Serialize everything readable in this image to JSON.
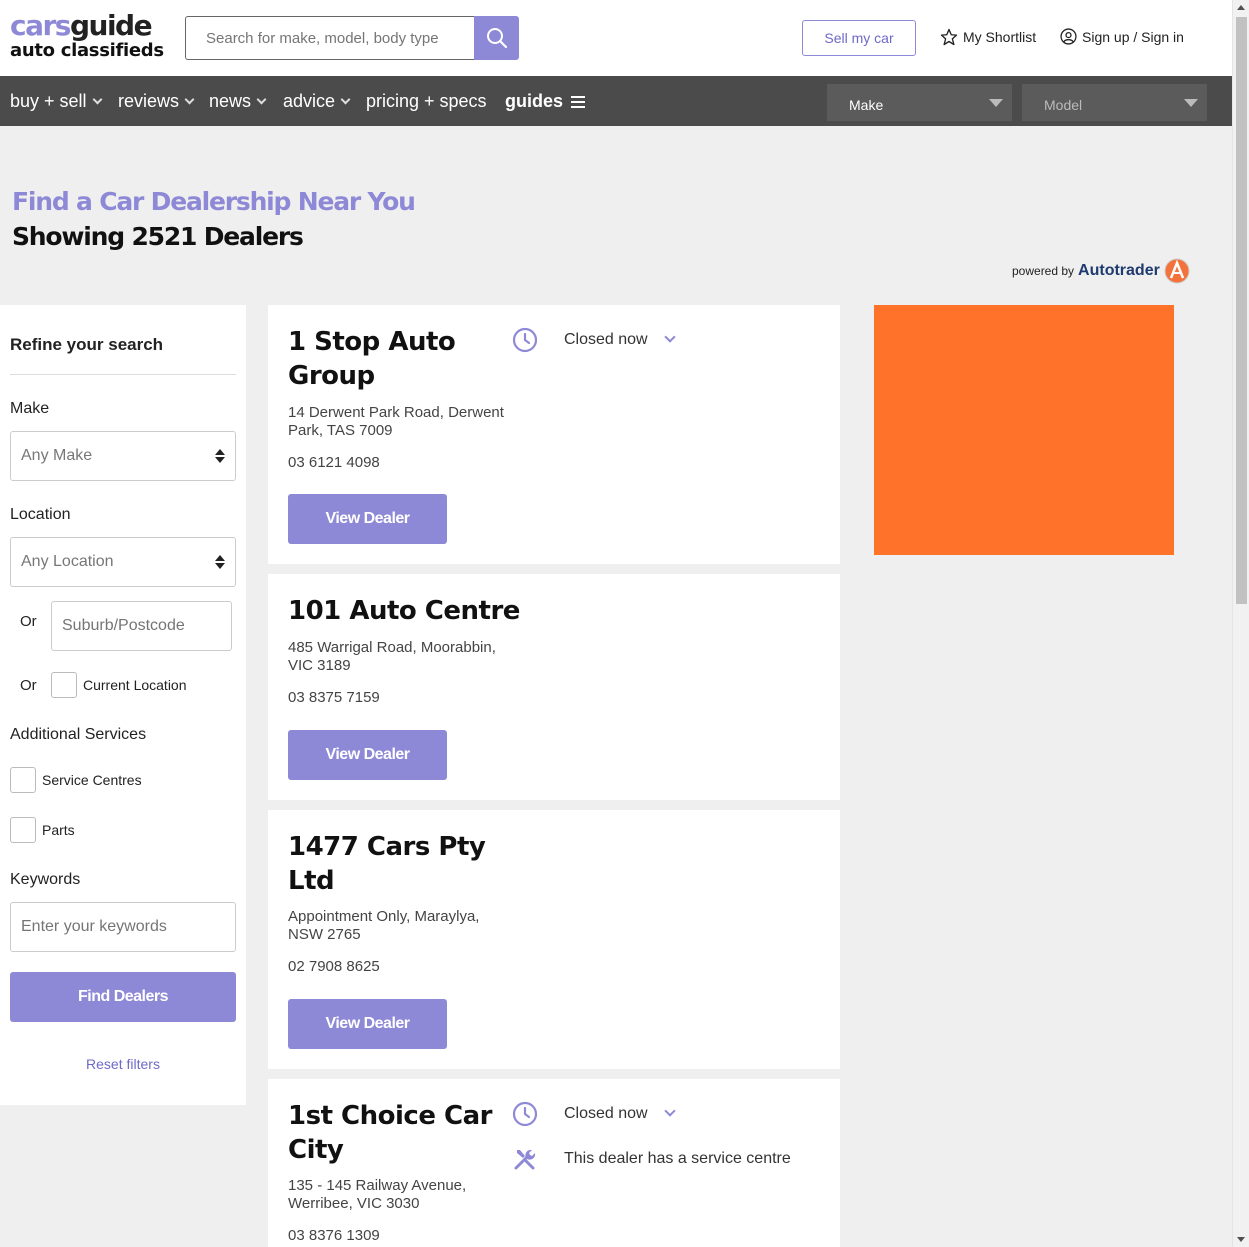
{
  "header": {
    "logo_part1": "cars",
    "logo_part2": "guide",
    "logo_sub": "auto classifieds",
    "search_placeholder": "Search for make, model, body type",
    "sell_label": "Sell my car",
    "shortlist_label": "My Shortlist",
    "signin_label": "Sign up / Sign in"
  },
  "nav": {
    "items": [
      "buy + sell",
      "reviews",
      "news",
      "advice",
      "pricing + specs",
      "guides"
    ],
    "make_label": "Make",
    "model_label": "Model"
  },
  "page": {
    "title": "Find a Car Dealership Near You",
    "subtitle": "Showing 2521 Dealers",
    "powered_by": "powered by",
    "powered_brand": "Autotrader"
  },
  "sidebar": {
    "title": "Refine your search",
    "make_label": "Make",
    "make_value": "Any Make",
    "location_label": "Location",
    "location_value": "Any Location",
    "or1": "Or",
    "suburb_placeholder": "Suburb/Postcode",
    "or2": "Or",
    "current_location": "Current Location",
    "additional_label": "Additional Services",
    "service_centres": "Service Centres",
    "parts": "Parts",
    "keywords_label": "Keywords",
    "keywords_placeholder": "Enter your keywords",
    "find_button": "Find Dealers",
    "reset": "Reset filters"
  },
  "dealers": [
    {
      "name": "1 Stop Auto Group",
      "address": "14 Derwent Park Road, Derwent Park, TAS 7009",
      "phone": "03 6121 4098",
      "button": "View Dealer",
      "status": "Closed now"
    },
    {
      "name": "101 Auto Centre",
      "address": "485 Warrigal Road, Moorabbin, VIC 3189",
      "phone": "03 8375 7159",
      "button": "View Dealer"
    },
    {
      "name": "1477 Cars Pty Ltd",
      "address": "Appointment Only, Maraylya, NSW 2765",
      "phone": "02 7908 8625",
      "button": "View Dealer"
    },
    {
      "name": "1st Choice Car City",
      "address": "135 - 145 Railway Avenue, Werribee, VIC 3030",
      "phone": "03 8376 1309",
      "status": "Closed now",
      "service": "This dealer has a service centre"
    }
  ],
  "colors": {
    "accent": "#8e89d6",
    "nav_bg": "#4b4b4b",
    "ad_bg": "#fe7229"
  }
}
